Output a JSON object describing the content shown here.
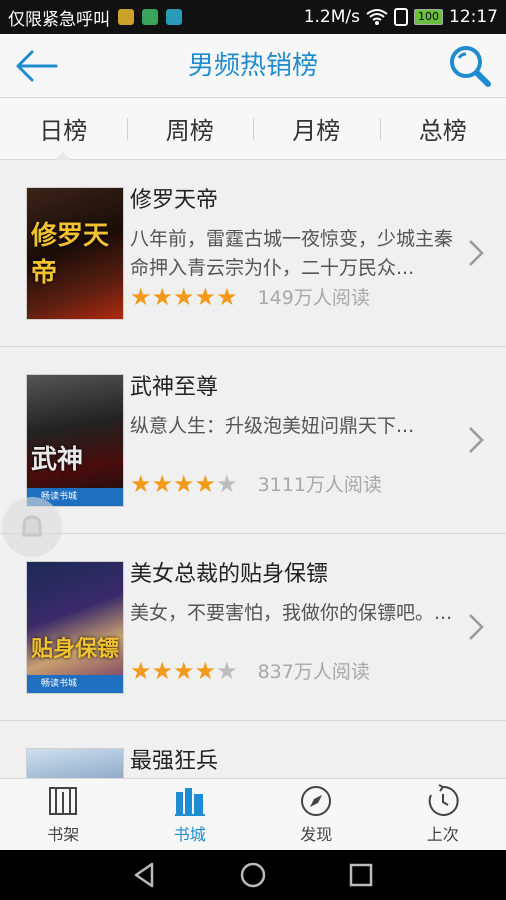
{
  "status_bar": {
    "carrier": "仅限紧急呼叫",
    "speed": "1.2M/s",
    "battery": "100",
    "time": "12:17"
  },
  "header": {
    "title": "男频热销榜",
    "accent_color": "#1f8ccf"
  },
  "tabs": [
    {
      "label": "日榜",
      "active": true
    },
    {
      "label": "周榜",
      "active": false
    },
    {
      "label": "月榜",
      "active": false
    },
    {
      "label": "总榜",
      "active": false
    }
  ],
  "books": [
    {
      "title": "修罗天帝",
      "desc": "八年前，雷霆古城一夜惊变，少城主秦命押入青云宗为仆，二十万民众...",
      "stars": 5,
      "readers": "149万人阅读",
      "cover_text": "修罗天帝",
      "cover_tag": ""
    },
    {
      "title": "武神至尊",
      "desc": "纵意人生：升级泡美妞问鼎天下...",
      "stars": 4,
      "readers": "3111万人阅读",
      "cover_text": "武神",
      "cover_tag": "畅读书城"
    },
    {
      "title": "美女总裁的贴身保镖",
      "desc": "美女，不要害怕，我做你的保镖吧。...",
      "stars": 4,
      "readers": "837万人阅读",
      "cover_text": "贴身保镖",
      "cover_tag": "畅读书城"
    },
    {
      "title": "最强狂兵",
      "desc": "",
      "stars": 0,
      "readers": "",
      "cover_text": "",
      "cover_tag": ""
    }
  ],
  "bottom_nav": [
    {
      "label": "书架",
      "icon": "bookshelf-icon",
      "active": false
    },
    {
      "label": "书城",
      "icon": "bookstore-icon",
      "active": true
    },
    {
      "label": "发现",
      "icon": "compass-icon",
      "active": false
    },
    {
      "label": "上次",
      "icon": "history-icon",
      "active": false
    }
  ]
}
